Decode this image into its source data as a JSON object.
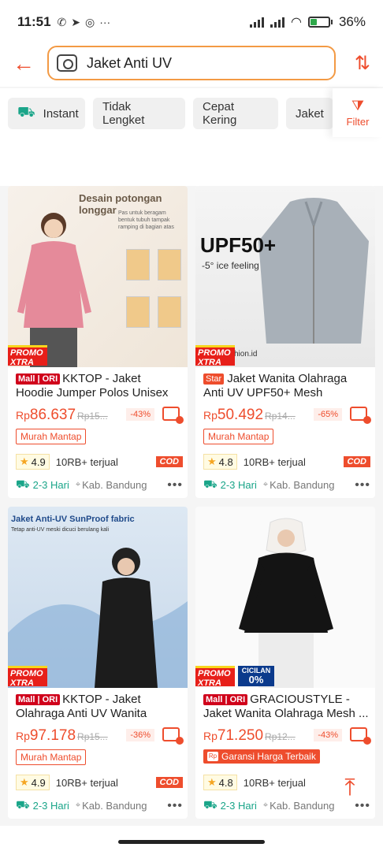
{
  "status": {
    "time": "11:51",
    "apps": [
      "whatsapp-icon",
      "telegram-icon",
      "instagram-icon",
      "more-icon"
    ],
    "more": "···",
    "battery": "36%"
  },
  "search": {
    "query": "Jaket Anti UV"
  },
  "chips": [
    {
      "label": "Instant"
    },
    {
      "label": "Tidak Lengket"
    },
    {
      "label": "Cepat Kering"
    },
    {
      "label": "Jaket"
    }
  ],
  "filter_label": "Filter",
  "products": [
    {
      "image_text": "Desain potongan longgar",
      "image_subtext": "Pas untuk beragam bentuk tubuh tampak ramping di bagian atas",
      "badge": "PROMO XTRA",
      "shop_tag": "Mall | ORI",
      "title": "KKTOP - Jaket Hoodie Jumper Polos Unisex ...",
      "price_currency": "Rp",
      "price": "86.637",
      "price_old": "Rp15...",
      "discount": "-43%",
      "tag": "Murah Mantap",
      "rating": "4.9",
      "sold": "10RB+ terjual",
      "cod": "COD",
      "ship": "2-3 Hari",
      "location": "Kab. Bandung"
    },
    {
      "image_text": "UPF50+",
      "image_subtext": "-5° ice feeling",
      "watermark": "shion.id",
      "badge": "PROMO XTRA",
      "shop_tag": "Star",
      "title": "Jaket Wanita Olahraga Anti UV UPF50+ Mesh",
      "price_currency": "Rp",
      "price": "50.492",
      "price_old": "Rp14...",
      "discount": "-65%",
      "tag": "Murah Mantap",
      "rating": "4.8",
      "sold": "10RB+ terjual",
      "cod": "COD",
      "ship": "2-3 Hari",
      "location": "Kab. Bandung"
    },
    {
      "image_text": "Jaket Anti-UV SunProof fabric",
      "image_subtext": "Tetap anti-UV meski dicuci berulang kali",
      "badge": "PROMO XTRA",
      "shop_tag": "Mall | ORI",
      "title": "KKTOP - Jaket Olahraga Anti UV Wanita Baju...",
      "price_currency": "Rp",
      "price": "97.178",
      "price_old": "Rp15...",
      "discount": "-36%",
      "tag": "Murah Mantap",
      "rating": "4.9",
      "sold": "10RB+ terjual",
      "cod": "COD",
      "ship": "2-3 Hari",
      "location": "Kab. Bandung"
    },
    {
      "badge": "PROMO XTRA",
      "badge2_top": "CICILAN",
      "badge2_bottom": "0%",
      "shop_tag": "Mall | ORI",
      "title": "GRACIOUSTYLE - Jaket Wanita Olahraga Mesh ...",
      "price_currency": "Rp",
      "price": "71.250",
      "price_old": "Rp12...",
      "discount": "-43%",
      "tag": "Garansi Harga Terbaik",
      "rating": "4.8",
      "sold": "10RB+ terjual",
      "ship": "2-3 Hari",
      "location": "Kab. Bandung"
    }
  ],
  "colors": {
    "accent": "#ee4d2d",
    "ship": "#1aa589",
    "mall": "#d0011b",
    "search_border": "#f39a44"
  }
}
